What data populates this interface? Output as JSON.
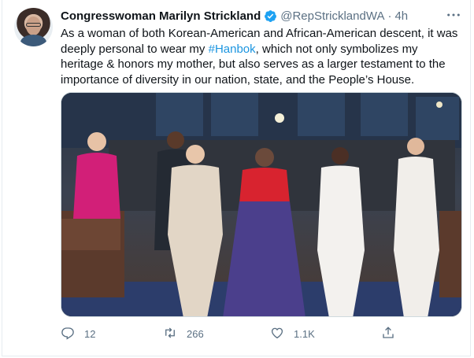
{
  "tweet": {
    "author_name": "Congresswoman Marilyn Strickland",
    "handle": "@RepStricklandWA",
    "separator": "·",
    "time": "4h",
    "text_before": "As a woman of both Korean-American and African-American descent, it was deeply personal to wear my ",
    "hashtag": "#Hanbok",
    "text_after": ", which not only symbolizes my heritage & honors my mother, but also serves as a larger testament to the importance of diversity in our nation, state, and the People’s House."
  },
  "actions": {
    "replies": "12",
    "retweets": "266",
    "likes": "1.1K"
  },
  "icons": {
    "verified": "verified-badge-icon",
    "more": "more-options-icon",
    "reply": "reply-icon",
    "retweet": "retweet-icon",
    "like": "like-icon",
    "share": "share-icon"
  },
  "colors": {
    "accent": "#1b95e0",
    "secondary_text": "#5b7083",
    "verified": "#1da1f2"
  }
}
